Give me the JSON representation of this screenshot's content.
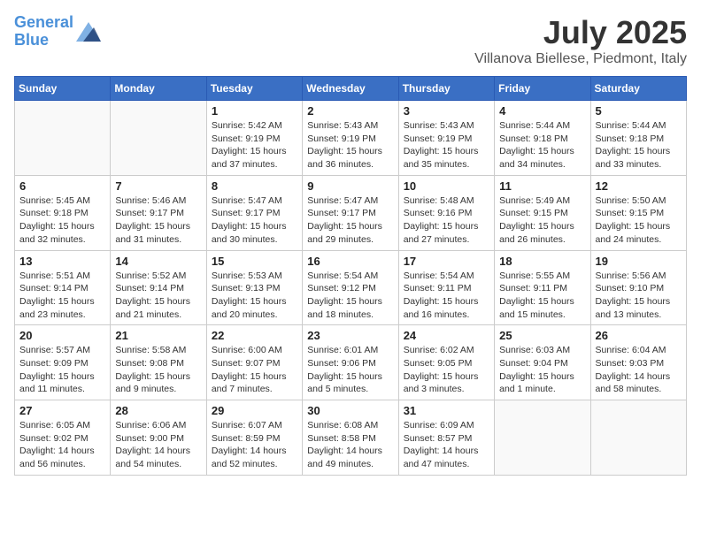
{
  "header": {
    "logo_line1": "General",
    "logo_line2": "Blue",
    "title": "July 2025",
    "subtitle": "Villanova Biellese, Piedmont, Italy"
  },
  "weekdays": [
    "Sunday",
    "Monday",
    "Tuesday",
    "Wednesday",
    "Thursday",
    "Friday",
    "Saturday"
  ],
  "weeks": [
    [
      {
        "day": "",
        "info": ""
      },
      {
        "day": "",
        "info": ""
      },
      {
        "day": "1",
        "info": "Sunrise: 5:42 AM\nSunset: 9:19 PM\nDaylight: 15 hours\nand 37 minutes."
      },
      {
        "day": "2",
        "info": "Sunrise: 5:43 AM\nSunset: 9:19 PM\nDaylight: 15 hours\nand 36 minutes."
      },
      {
        "day": "3",
        "info": "Sunrise: 5:43 AM\nSunset: 9:19 PM\nDaylight: 15 hours\nand 35 minutes."
      },
      {
        "day": "4",
        "info": "Sunrise: 5:44 AM\nSunset: 9:18 PM\nDaylight: 15 hours\nand 34 minutes."
      },
      {
        "day": "5",
        "info": "Sunrise: 5:44 AM\nSunset: 9:18 PM\nDaylight: 15 hours\nand 33 minutes."
      }
    ],
    [
      {
        "day": "6",
        "info": "Sunrise: 5:45 AM\nSunset: 9:18 PM\nDaylight: 15 hours\nand 32 minutes."
      },
      {
        "day": "7",
        "info": "Sunrise: 5:46 AM\nSunset: 9:17 PM\nDaylight: 15 hours\nand 31 minutes."
      },
      {
        "day": "8",
        "info": "Sunrise: 5:47 AM\nSunset: 9:17 PM\nDaylight: 15 hours\nand 30 minutes."
      },
      {
        "day": "9",
        "info": "Sunrise: 5:47 AM\nSunset: 9:17 PM\nDaylight: 15 hours\nand 29 minutes."
      },
      {
        "day": "10",
        "info": "Sunrise: 5:48 AM\nSunset: 9:16 PM\nDaylight: 15 hours\nand 27 minutes."
      },
      {
        "day": "11",
        "info": "Sunrise: 5:49 AM\nSunset: 9:15 PM\nDaylight: 15 hours\nand 26 minutes."
      },
      {
        "day": "12",
        "info": "Sunrise: 5:50 AM\nSunset: 9:15 PM\nDaylight: 15 hours\nand 24 minutes."
      }
    ],
    [
      {
        "day": "13",
        "info": "Sunrise: 5:51 AM\nSunset: 9:14 PM\nDaylight: 15 hours\nand 23 minutes."
      },
      {
        "day": "14",
        "info": "Sunrise: 5:52 AM\nSunset: 9:14 PM\nDaylight: 15 hours\nand 21 minutes."
      },
      {
        "day": "15",
        "info": "Sunrise: 5:53 AM\nSunset: 9:13 PM\nDaylight: 15 hours\nand 20 minutes."
      },
      {
        "day": "16",
        "info": "Sunrise: 5:54 AM\nSunset: 9:12 PM\nDaylight: 15 hours\nand 18 minutes."
      },
      {
        "day": "17",
        "info": "Sunrise: 5:54 AM\nSunset: 9:11 PM\nDaylight: 15 hours\nand 16 minutes."
      },
      {
        "day": "18",
        "info": "Sunrise: 5:55 AM\nSunset: 9:11 PM\nDaylight: 15 hours\nand 15 minutes."
      },
      {
        "day": "19",
        "info": "Sunrise: 5:56 AM\nSunset: 9:10 PM\nDaylight: 15 hours\nand 13 minutes."
      }
    ],
    [
      {
        "day": "20",
        "info": "Sunrise: 5:57 AM\nSunset: 9:09 PM\nDaylight: 15 hours\nand 11 minutes."
      },
      {
        "day": "21",
        "info": "Sunrise: 5:58 AM\nSunset: 9:08 PM\nDaylight: 15 hours\nand 9 minutes."
      },
      {
        "day": "22",
        "info": "Sunrise: 6:00 AM\nSunset: 9:07 PM\nDaylight: 15 hours\nand 7 minutes."
      },
      {
        "day": "23",
        "info": "Sunrise: 6:01 AM\nSunset: 9:06 PM\nDaylight: 15 hours\nand 5 minutes."
      },
      {
        "day": "24",
        "info": "Sunrise: 6:02 AM\nSunset: 9:05 PM\nDaylight: 15 hours\nand 3 minutes."
      },
      {
        "day": "25",
        "info": "Sunrise: 6:03 AM\nSunset: 9:04 PM\nDaylight: 15 hours\nand 1 minute."
      },
      {
        "day": "26",
        "info": "Sunrise: 6:04 AM\nSunset: 9:03 PM\nDaylight: 14 hours\nand 58 minutes."
      }
    ],
    [
      {
        "day": "27",
        "info": "Sunrise: 6:05 AM\nSunset: 9:02 PM\nDaylight: 14 hours\nand 56 minutes."
      },
      {
        "day": "28",
        "info": "Sunrise: 6:06 AM\nSunset: 9:00 PM\nDaylight: 14 hours\nand 54 minutes."
      },
      {
        "day": "29",
        "info": "Sunrise: 6:07 AM\nSunset: 8:59 PM\nDaylight: 14 hours\nand 52 minutes."
      },
      {
        "day": "30",
        "info": "Sunrise: 6:08 AM\nSunset: 8:58 PM\nDaylight: 14 hours\nand 49 minutes."
      },
      {
        "day": "31",
        "info": "Sunrise: 6:09 AM\nSunset: 8:57 PM\nDaylight: 14 hours\nand 47 minutes."
      },
      {
        "day": "",
        "info": ""
      },
      {
        "day": "",
        "info": ""
      }
    ]
  ]
}
